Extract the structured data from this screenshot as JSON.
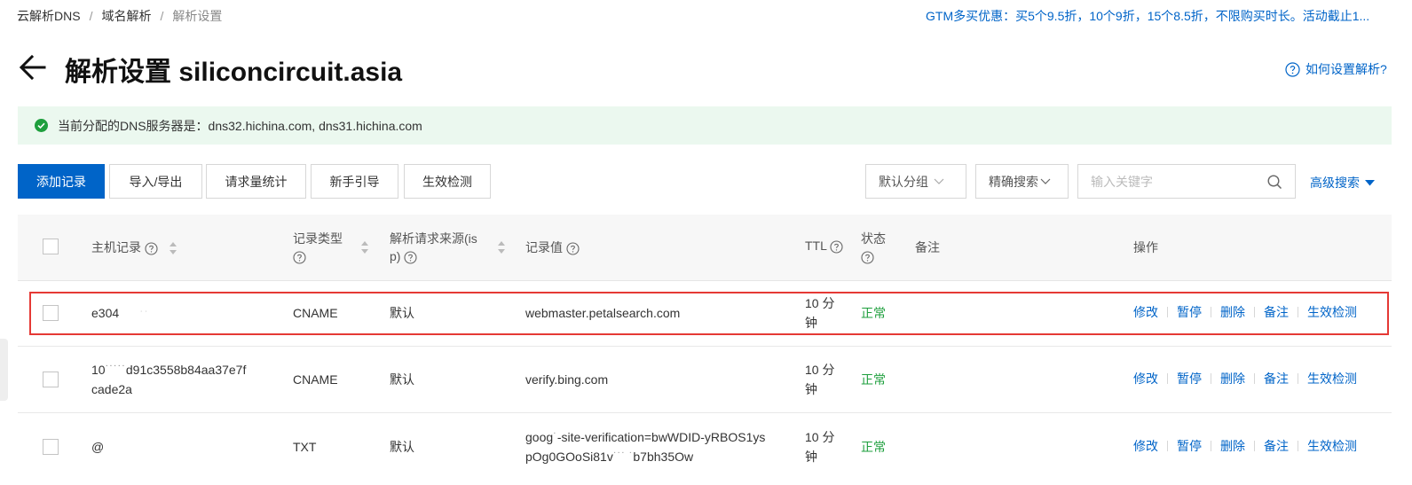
{
  "breadcrumb": {
    "items": [
      "云解析DNS",
      "域名解析",
      "解析设置"
    ],
    "separator": "/"
  },
  "promo_text": "GTM多买优惠：买5个9.5折，10个9折，15个8.5折，不限购买时长。活动截止1...",
  "title": "解析设置 siliconcircuit.asia",
  "help_link": "如何设置解析?",
  "notice": {
    "text": "当前分配的DNS服务器是：dns32.hichina.com, dns31.hichina.com",
    "color": "#ebf8ef"
  },
  "toolbar": {
    "add_record": "添加记录",
    "import_export": "导入/导出",
    "request_stats": "请求量统计",
    "guide": "新手引导",
    "effect_check": "生效检测",
    "group_select": "默认分组",
    "search_mode": "精确搜索",
    "search_placeholder": "输入关键字",
    "advanced_search": "高级搜索"
  },
  "columns": {
    "host": "主机记录",
    "type_line1": "记录类型",
    "source_line1": "解析请求来源(is",
    "source_line2": "p)",
    "value": "记录值",
    "ttl": "TTL",
    "status_line1": "状态",
    "remark": "备注",
    "actions": "操作"
  },
  "records": [
    {
      "host_line1": "e304",
      "host_line2": "",
      "type": "CNAME",
      "source": "默认",
      "value_line1": "webmaster.petalsearch.com",
      "value_line2": "",
      "ttl_line1": "10 分",
      "ttl_line2": "钟",
      "status": "正常"
    },
    {
      "host_line1": "10",
      "host_line1b": "d91c3558b84aa37e7f",
      "host_line2": "cade2a",
      "type": "CNAME",
      "source": "默认",
      "value_line1": "verify.bing.com",
      "value_line2": "",
      "ttl_line1": "10 分",
      "ttl_line2": "钟",
      "status": "正常"
    },
    {
      "host_line1": "@",
      "host_line2": "",
      "type": "TXT",
      "source": "默认",
      "value_line1": "goog",
      "value_line1b": "-site-verification=bwWDID-yRBOS1ys",
      "value_line2": "pOg0GOoSi81v",
      "value_line2b": "b7bh35Ow",
      "ttl_line1": "10 分",
      "ttl_line2": "钟",
      "status": "正常"
    }
  ],
  "row_actions": [
    "修改",
    "暂停",
    "删除",
    "备注",
    "生效检测"
  ],
  "colors": {
    "accent": "#0064c8",
    "status_ok": "#1e9f3d",
    "highlight_border": "#e53935"
  }
}
